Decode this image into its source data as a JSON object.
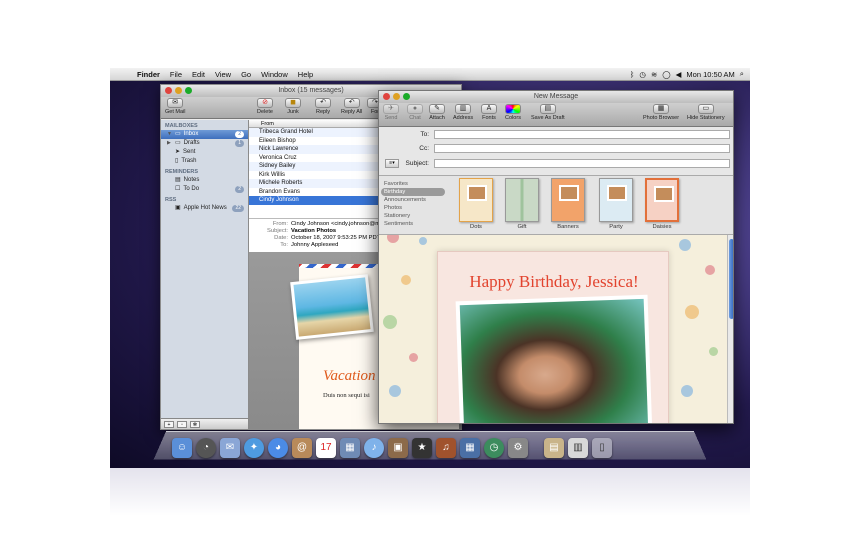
{
  "menubar": {
    "app": "Finder",
    "items": [
      "File",
      "Edit",
      "View",
      "Go",
      "Window",
      "Help"
    ],
    "clock": "Mon 10:50 AM"
  },
  "mail": {
    "title": "Inbox (15 messages)",
    "toolbar": {
      "get_mail": "Get Mail",
      "delete": "Delete",
      "junk": "Junk",
      "reply": "Reply",
      "reply_all": "Reply All",
      "forward": "For"
    },
    "mailboxes_header": "MAILBOXES",
    "mailboxes": [
      {
        "label": "Inbox",
        "count": "2"
      },
      {
        "label": "Drafts",
        "count": "1"
      },
      {
        "label": "Sent",
        "count": ""
      },
      {
        "label": "Trash",
        "count": ""
      }
    ],
    "reminders_header": "REMINDERS",
    "reminders": [
      {
        "label": "Notes",
        "count": ""
      },
      {
        "label": "To Do",
        "count": "2"
      }
    ],
    "rss_header": "RSS",
    "rss": [
      {
        "label": "Apple Hot News",
        "count": "22"
      }
    ],
    "list_header": "From",
    "messages": [
      "Tribeca Grand Hotel",
      "Eileen Bishop",
      "Nick Lawrence",
      "Veronica Cruz",
      "Sidney Bailey",
      "Kirk Willis",
      "Michele Roberts",
      "Brandon Evans",
      "Cindy Johnson"
    ],
    "header": {
      "from_label": "From:",
      "from": "Cindy Johnson <cindy.johnson@ma",
      "subject_label": "Subject:",
      "subject": "Vacation Photos",
      "date_label": "Date:",
      "date": "October 18, 2007 9:53:25 PM PDT",
      "to_label": "To:",
      "to": "Johnny Appleseed"
    },
    "body_title": "Vacation",
    "body_text": "Duis non sequi isi"
  },
  "new_message": {
    "title": "New Message",
    "toolbar": {
      "send": "Send",
      "chat": "Chat",
      "attach": "Attach",
      "address": "Address",
      "fonts": "Fonts",
      "colors": "Colors",
      "save_draft": "Save As Draft",
      "photo_browser": "Photo Browser",
      "hide_stationery": "Hide Stationery"
    },
    "to_label": "To:",
    "cc_label": "Cc:",
    "subject_label": "Subject:",
    "categories": [
      "Favorites",
      "Birthday",
      "Announcements",
      "Photos",
      "Stationery",
      "Sentiments"
    ],
    "templates": [
      "Dots",
      "Gift",
      "Banners",
      "Party",
      "Daisies"
    ],
    "card_title": "Happy Birthday, Jessica!"
  }
}
